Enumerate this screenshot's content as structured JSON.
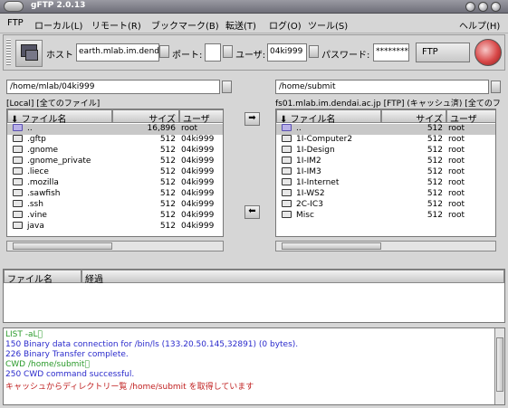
{
  "window": {
    "title": "gFTP 2.0.13"
  },
  "menu": {
    "items": [
      "FTP",
      "ローカル(L)",
      "リモート(R)",
      "ブックマーク(B)",
      "転送(T)",
      "ログ(O)",
      "ツール(S)"
    ],
    "help": "ヘルプ(H)"
  },
  "toolbar": {
    "host_label": "ホスト",
    "host_value": "earth.mlab.im.dendai",
    "port_label": "ポート:",
    "port_value": "",
    "user_label": "ユーザ:",
    "user_value": "04ki999",
    "password_label": "パスワード:",
    "password_value": "********",
    "protocol_value": "FTP",
    "connect_icon": "computers-icon",
    "stop_icon": "stop-icon"
  },
  "local": {
    "path": "/home/mlab/04ki999",
    "info": "[Local] [全てのファイル]",
    "headers": {
      "name": "ファイル名",
      "size": "サイズ",
      "user": "ユーザ"
    },
    "rows": [
      {
        "name": "..",
        "size": "16,896",
        "user": "root",
        "up": true
      },
      {
        "name": ".gftp",
        "size": "512",
        "user": "04ki999"
      },
      {
        "name": ".gnome",
        "size": "512",
        "user": "04ki999"
      },
      {
        "name": ".gnome_private",
        "size": "512",
        "user": "04ki999"
      },
      {
        "name": ".liece",
        "size": "512",
        "user": "04ki999"
      },
      {
        "name": ".mozilla",
        "size": "512",
        "user": "04ki999"
      },
      {
        "name": ".sawfish",
        "size": "512",
        "user": "04ki999"
      },
      {
        "name": ".ssh",
        "size": "512",
        "user": "04ki999"
      },
      {
        "name": ".vine",
        "size": "512",
        "user": "04ki999"
      },
      {
        "name": "java",
        "size": "512",
        "user": "04ki999"
      }
    ]
  },
  "remote": {
    "path": "/home/submit",
    "info": "fs01.mlab.im.dendai.ac.jp [FTP] (キャッシュ済) [全てのフ",
    "headers": {
      "name": "ファイル名",
      "size": "サイズ",
      "user": "ユーザ"
    },
    "rows": [
      {
        "name": "..",
        "size": "512",
        "user": "root",
        "up": true
      },
      {
        "name": "1I-Computer2",
        "size": "512",
        "user": "root"
      },
      {
        "name": "1I-Design",
        "size": "512",
        "user": "root"
      },
      {
        "name": "1I-IM2",
        "size": "512",
        "user": "root"
      },
      {
        "name": "1I-IM3",
        "size": "512",
        "user": "root"
      },
      {
        "name": "1I-Internet",
        "size": "512",
        "user": "root"
      },
      {
        "name": "1I-WS2",
        "size": "512",
        "user": "root"
      },
      {
        "name": "2C-IC3",
        "size": "512",
        "user": "root"
      },
      {
        "name": "Misc",
        "size": "512",
        "user": "root"
      }
    ]
  },
  "transfer": {
    "upload_arrow": "➡",
    "download_arrow": "⬅",
    "headers": {
      "file": "ファイル名",
      "progress": "経過"
    }
  },
  "log": {
    "lines": [
      {
        "text": "LIST -aL⃞",
        "color": "#2a9a2a"
      },
      {
        "text": "150 Binary data connection for /bin/ls (133.20.50.145,32891) (0 bytes).",
        "color": "#2a2acc"
      },
      {
        "text": "226 Binary Transfer complete.",
        "color": "#2a2acc"
      },
      {
        "text": "CWD /home/submit⃞",
        "color": "#2a9a2a"
      },
      {
        "text": "250 CWD command successful.",
        "color": "#2a2acc"
      },
      {
        "text": "キャッシュからディレクトリー覧 /home/submit を取得しています",
        "color": "#c02020"
      }
    ]
  }
}
